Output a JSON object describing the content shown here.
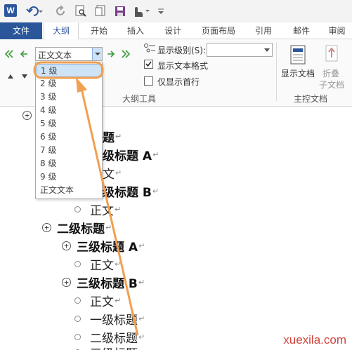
{
  "quick_access": {
    "logo_letter": "W"
  },
  "tabs": [
    {
      "label": "文件"
    },
    {
      "label": "大纲"
    },
    {
      "label": "开始"
    },
    {
      "label": "插入"
    },
    {
      "label": "设计"
    },
    {
      "label": "页面布局"
    },
    {
      "label": "引用"
    },
    {
      "label": "邮件"
    },
    {
      "label": "审阅"
    }
  ],
  "ribbon": {
    "level_select_value": "正文文本",
    "show_level_label": "显示级别(S):",
    "show_text_format_label": "显示文本格式",
    "show_text_format_checked": true,
    "first_line_only_label": "仅显示首行",
    "first_line_only_checked": false,
    "group_outline_tools": "大纲工具",
    "show_document_label": "显示文档",
    "collapse_subdoc_label_1": "折叠",
    "collapse_subdoc_label_2": "子文档",
    "group_master_doc": "主控文档"
  },
  "dropdown": {
    "items": [
      "1 级",
      "2 级",
      "3 级",
      "4 级",
      "5 级",
      "6 级",
      "7 级",
      "8 级",
      "9 级",
      "正文文本"
    ],
    "selected_index": 0
  },
  "outline": {
    "l1_partial": "题",
    "l2_partial": "级标题 A",
    "l3_partial": "文",
    "l4_partial": "级标题 B",
    "l5": "正文",
    "l6": "二级标题",
    "l7": "三级标题 A",
    "l8": "正文",
    "l9": "三级标题 B",
    "l10": "正文",
    "l11": "一级标题",
    "l12": "二级标题",
    "l13_partial": "三级标题",
    "para_mark": "↵"
  },
  "watermark": "xuexila.com",
  "colors": {
    "accent": "#2b579a",
    "arrow": "#f0a050",
    "highlight": "#f0a050"
  }
}
